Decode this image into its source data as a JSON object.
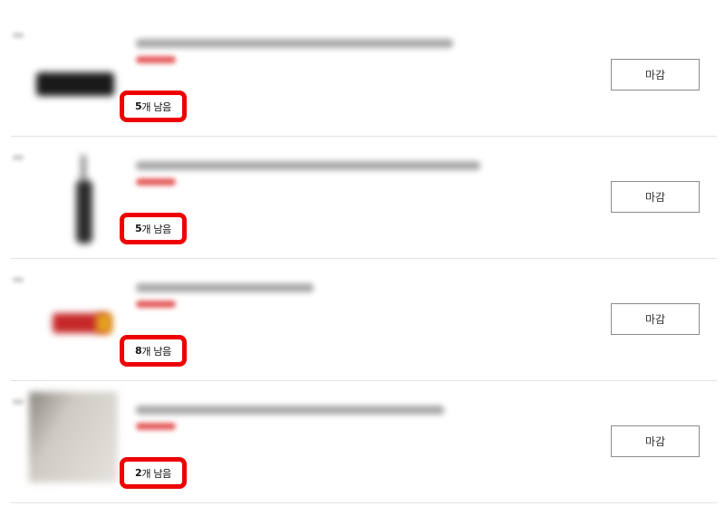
{
  "items": [
    {
      "stock_count": "5",
      "stock_suffix": "개 남음",
      "button_label": "마감",
      "thumb": "black-device"
    },
    {
      "stock_count": "5",
      "stock_suffix": "개 남음",
      "button_label": "마감",
      "thumb": "vertical-tool"
    },
    {
      "stock_count": "8",
      "stock_suffix": "개 남음",
      "button_label": "마감",
      "thumb": "red-box"
    },
    {
      "stock_count": "2",
      "stock_suffix": "개 남음",
      "button_label": "마감",
      "thumb": "grey-sheet"
    }
  ],
  "colors": {
    "highlight": "#ee0000",
    "price": "#e24b4b",
    "border": "#8c8c8c"
  }
}
